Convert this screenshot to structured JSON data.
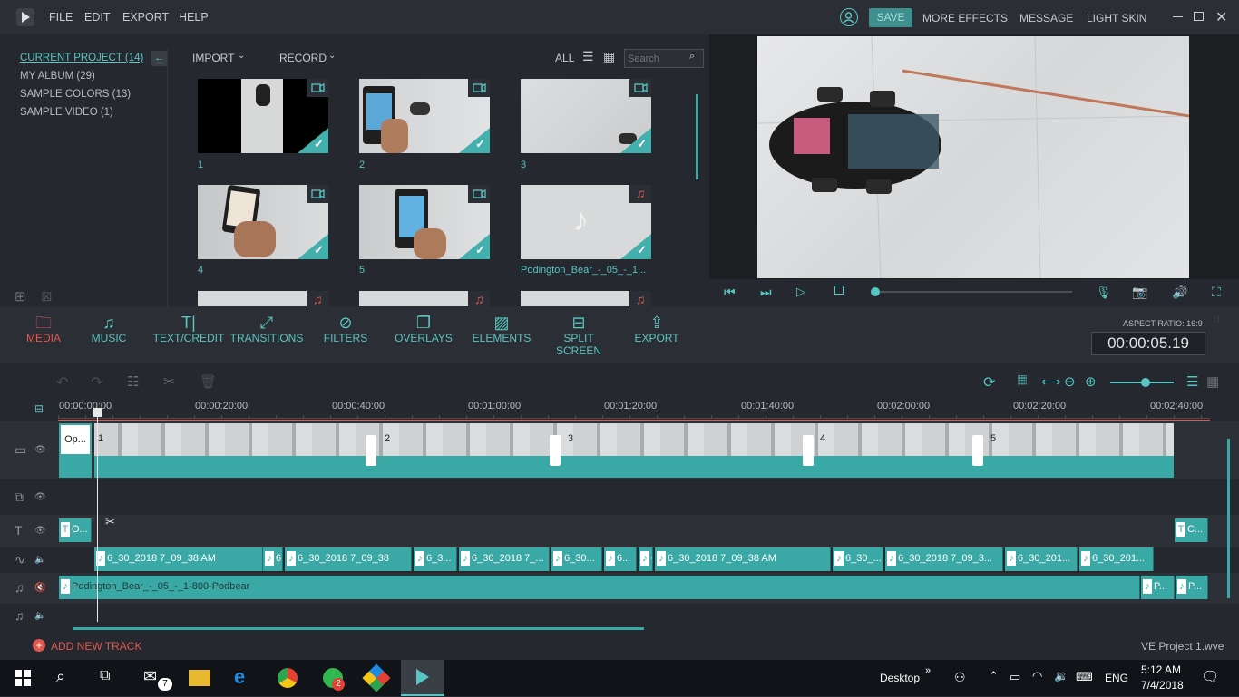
{
  "menu": {
    "file": "FILE",
    "edit": "EDIT",
    "export": "EXPORT",
    "help": "HELP"
  },
  "topright": {
    "save": "SAVE",
    "more_effects": "MORE EFFECTS",
    "message": "MESSAGE",
    "light_skin": "LIGHT SKIN"
  },
  "library": {
    "items": [
      "CURRENT PROJECT (14)",
      "MY ALBUM (29)",
      "SAMPLE COLORS (13)",
      "SAMPLE VIDEO (1)"
    ]
  },
  "media_bar": {
    "import": "IMPORT",
    "record": "RECORD",
    "all": "ALL",
    "search_placeholder": "Search"
  },
  "thumbs": [
    "1",
    "2",
    "3",
    "4",
    "5",
    "Podington_Bear_-_05_-_1..."
  ],
  "toolbar": {
    "media": "MEDIA",
    "music": "MUSIC",
    "text": "TEXT/CREDIT",
    "transitions": "TRANSITIONS",
    "filters": "FILTERS",
    "overlays": "OVERLAYS",
    "elements": "ELEMENTS",
    "split": "SPLIT SCREEN",
    "export": "EXPORT"
  },
  "aspect": {
    "label": "ASPECT RATIO: 16:9",
    "timecode": "00:00:05.19"
  },
  "ruler": [
    "00:00:00:00",
    "00:00:20:00",
    "00:00:40:00",
    "00:01:00:00",
    "00:01:20:00",
    "00:01:40:00",
    "00:02:00:00",
    "00:02:20:00",
    "00:02:40:00"
  ],
  "video_clips": {
    "opener": "Op...",
    "c1": "1",
    "c2": "2",
    "c3": "3",
    "c4": "4",
    "c5": "5"
  },
  "text_clips": {
    "a": "O...",
    "b": "C..."
  },
  "audio1": [
    "6_30_2018 7_09_38 AM",
    "6",
    "6_30_2018 7_09_38",
    "6_3...",
    "6_30_2018 7_...",
    "6_30...",
    "6...",
    "6",
    "6_30_2018 7_09_38 AM",
    "6_30_...",
    "6_30_2018 7_09_3...",
    "6_30_201...",
    "6_30_201..."
  ],
  "audio2": {
    "main": "Podington_Bear_-_05_-_1-800-Podbear",
    "b": "P...",
    "c": "P..."
  },
  "footer": {
    "add_track": "ADD NEW TRACK",
    "project": "VE Project 1.wve"
  },
  "taskbar": {
    "desktop": "Desktop",
    "lang": "ENG",
    "time": "5:12 AM",
    "date": "7/4/2018",
    "mail_badge": "7",
    "whatsapp_badge": "2"
  },
  "colors": {
    "accent": "#43b0ad",
    "active": "#e0584f"
  }
}
